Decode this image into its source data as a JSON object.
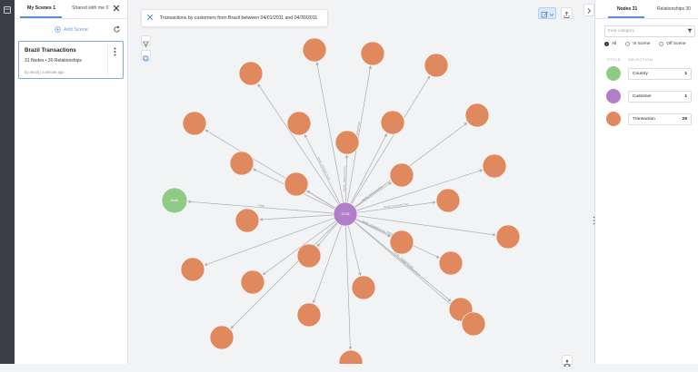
{
  "left_panel": {
    "tabs": [
      {
        "label": "My Scenes 1"
      },
      {
        "label": "Shared with me 0"
      }
    ],
    "add_scene_label": "Add Scene",
    "scene_card": {
      "title": "Brazil Transactions",
      "summary": "31 Nodes • 30 Relationships",
      "meta": "by neo4j | a minute ago"
    }
  },
  "canvas": {
    "query_text": "Transactions by customers from Brazil between 04/01/2011 and 04/30/2011",
    "relationship_labels": [
      "MADE_TRANSACTION",
      "MADE_TRANSACTION",
      "MADE_TRANSACTION",
      "MADE_TRANSACTION",
      "MADE_TRANSACTION",
      "MADE_TRANSACTION",
      "MADE_TRANSACTION",
      "MADE_TRANSACTION",
      "MADE_TRANSACTION",
      "MADE_TRANSACTION",
      "FROM"
    ],
    "center_node_label": "51245",
    "country_node_label": "Brazil"
  },
  "right_panel": {
    "tabs": [
      {
        "label": "Nodes 31"
      },
      {
        "label": "Relationships 30"
      }
    ],
    "find_placeholder": "Find category",
    "radio_options": [
      {
        "label": "All",
        "selected": true
      },
      {
        "label": "In Scene",
        "selected": false
      },
      {
        "label": "Off Scene",
        "selected": false
      }
    ],
    "column_heads": {
      "style": "STYLE",
      "selection": "SELECTION"
    },
    "categories": [
      {
        "label": "Country",
        "count": "1",
        "color": "#8fcb85"
      },
      {
        "label": "Customer",
        "count": "1",
        "color": "#b07fc8"
      },
      {
        "label": "Transaction",
        "count": "29",
        "color": "#e0885e"
      }
    ]
  },
  "colors": {
    "transaction": "#e0885e",
    "customer": "#b07fc8",
    "country": "#8fcb85",
    "accent": "#5a8fd6",
    "edge": "#a9adb3"
  },
  "icons": [
    "app-logo-icon",
    "close-icon",
    "plus-circle-icon",
    "refresh-icon",
    "more-vertical-icon",
    "filter-icon",
    "copy-icon",
    "edit-icon",
    "export-icon",
    "chevron-right-icon",
    "layout-icon",
    "drag-grip-icon"
  ]
}
